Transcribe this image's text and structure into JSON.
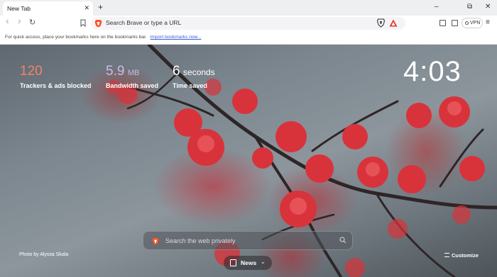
{
  "tab": {
    "title": "New Tab",
    "close_icon": "close-icon",
    "new_tab_label": "+"
  },
  "window": {
    "minimize": "–",
    "maximize": "⧉",
    "close": "✕"
  },
  "toolbar": {
    "back": "‹",
    "forward": "›",
    "reload": "↻",
    "bookmark_icon": "bookmark-icon",
    "url_placeholder": "Search Brave or type a URL",
    "vpn_label": "VPN",
    "menu": "≡"
  },
  "bookmarks_bar": {
    "hint": "For quick access, place your bookmarks here on the bookmarks bar.",
    "import_link": "Import bookmarks now..."
  },
  "stats": {
    "trackers": {
      "value": "120",
      "label": "Trackers & ads blocked"
    },
    "bandwidth": {
      "value": "5.9",
      "unit": "MB",
      "label": "Bandwidth saved"
    },
    "time": {
      "value": "6",
      "unit": "seconds",
      "label": "Time saved"
    }
  },
  "clock": "4:03",
  "search": {
    "placeholder": "Search the web privately"
  },
  "photo_credit": "Photo by Alyssa Skala",
  "news": {
    "label": "News"
  },
  "customize": {
    "label": "Customize"
  },
  "colors": {
    "trackers": "#f18366",
    "bandwidth": "#c6bde8",
    "brave_orange": "#fb542b"
  }
}
